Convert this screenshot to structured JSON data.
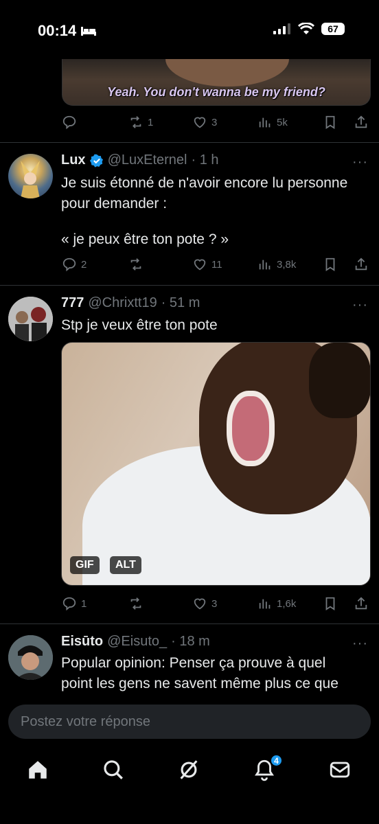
{
  "status": {
    "time": "00:14",
    "battery": "67"
  },
  "top_media": {
    "caption": "Yeah. You don't wanna be my friend?"
  },
  "top_actions": {
    "replies": "",
    "reposts": "1",
    "likes": "3",
    "views": "5k"
  },
  "tweets": [
    {
      "name": "Lux",
      "verified": true,
      "handle": "@LuxEternel",
      "time": "· 1 h",
      "lines": [
        "Je suis étonné de n'avoir encore lu personne",
        "pour demander :",
        "",
        "« je peux être ton pote ? »"
      ],
      "replies": "2",
      "reposts": "",
      "likes": "11",
      "views": "3,8k"
    },
    {
      "name": "777",
      "handle": "@Chrixtt19",
      "time": "· 51 m",
      "lines": [
        "Stp je veux être ton pote"
      ],
      "media_badges": [
        "GIF",
        "ALT"
      ],
      "replies": "1",
      "reposts": "",
      "likes": "3",
      "views": "1,6k"
    },
    {
      "name": "Eisūto",
      "handle": "@Eisuto_",
      "time": "· 18 m",
      "lines": [
        "Popular opinion: Penser ça prouve à quel",
        "point les gens ne savent même plus ce que"
      ]
    }
  ],
  "more_label": "···",
  "reply_placeholder": "Postez votre réponse",
  "tabs": {
    "notifications_count": "4"
  },
  "icons": [
    "bed-icon",
    "signal-icon",
    "wifi-icon",
    "reply-icon",
    "repost-icon",
    "like-icon",
    "views-icon",
    "bookmark-icon",
    "share-icon",
    "verified-icon",
    "home-icon",
    "search-icon",
    "grok-icon",
    "notifications-icon",
    "messages-icon"
  ],
  "colors": {
    "accent": "#1d9bf0",
    "muted": "#71767b",
    "text": "#e7e9ea",
    "background": "#000000"
  }
}
